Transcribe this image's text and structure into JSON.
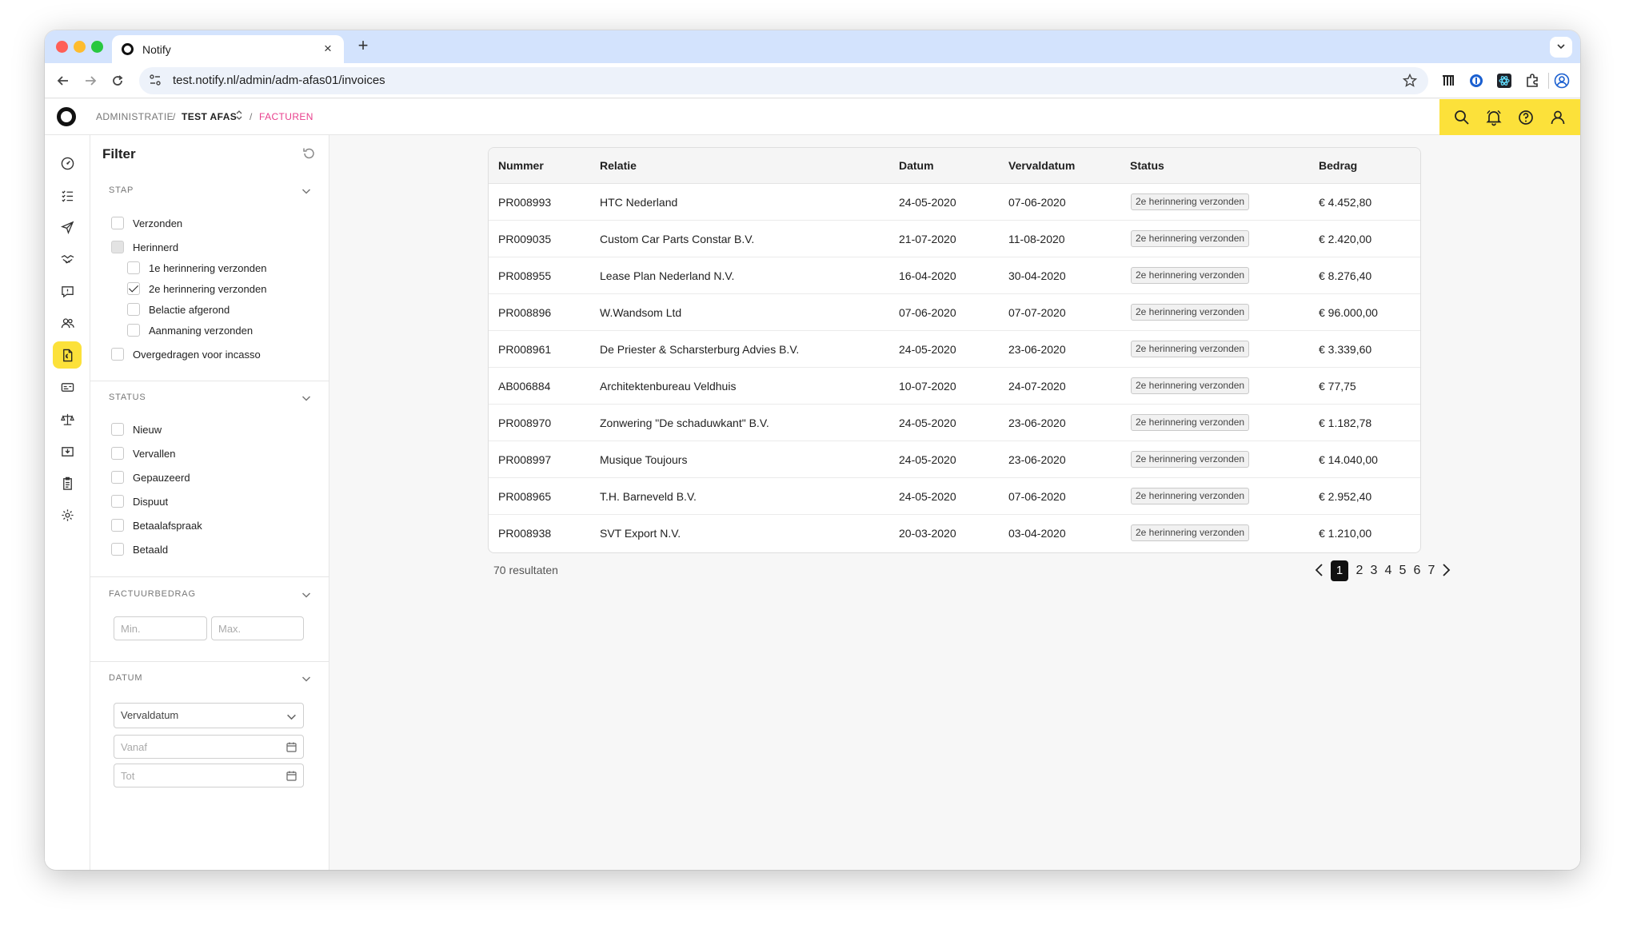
{
  "browser": {
    "tab_title": "Notify",
    "tab_close": "×",
    "new_tab": "+",
    "url": "test.notify.nl/admin/adm-afas01/invoices"
  },
  "header": {
    "breadcrumb": {
      "administratie": "ADMINISTRATIE",
      "sep1": "/",
      "test_afas": "TEST AFAS",
      "sep2": "/",
      "facturen": "FACTUREN"
    }
  },
  "rail": {
    "items": [
      "dashboard-icon",
      "tasks-icon",
      "send-icon",
      "handshake-icon",
      "chat-icon",
      "users-icon",
      "invoice-icon",
      "id-card-icon",
      "scale-icon",
      "inbox-icon",
      "clipboard-icon",
      "settings-icon"
    ],
    "active_index": 6
  },
  "filter": {
    "title": "Filter",
    "sections": {
      "stap": {
        "title": "STAP",
        "options": [
          {
            "label": "Verzonden",
            "state": "unchecked"
          },
          {
            "label": "Herinnerd",
            "state": "indeterminate"
          },
          {
            "label": "1e herinnering verzonden",
            "state": "unchecked",
            "sub": true
          },
          {
            "label": "2e herinnering verzonden",
            "state": "checked",
            "sub": true
          },
          {
            "label": "Belactie afgerond",
            "state": "unchecked",
            "sub": true
          },
          {
            "label": "Aanmaning verzonden",
            "state": "unchecked",
            "sub": true
          },
          {
            "label": "Overgedragen voor incasso",
            "state": "unchecked"
          }
        ]
      },
      "status": {
        "title": "STATUS",
        "options": [
          "Nieuw",
          "Vervallen",
          "Gepauzeerd",
          "Dispuut",
          "Betaalafspraak",
          "Betaald"
        ]
      },
      "factuurbedrag": {
        "title": "FACTUURBEDRAG",
        "min_placeholder": "Min.",
        "max_placeholder": "Max."
      },
      "datum": {
        "title": "DATUM",
        "select_value": "Vervaldatum",
        "from_placeholder": "Vanaf",
        "to_placeholder": "Tot"
      }
    }
  },
  "table": {
    "columns": [
      "Nummer",
      "Relatie",
      "Datum",
      "Vervaldatum",
      "Status",
      "Bedrag"
    ],
    "rows": [
      [
        "PR008993",
        "HTC Nederland",
        "24-05-2020",
        "07-06-2020",
        "2e herinnering verzonden",
        "€ 4.452,80"
      ],
      [
        "PR009035",
        "Custom Car Parts Constar B.V.",
        "21-07-2020",
        "11-08-2020",
        "2e herinnering verzonden",
        "€ 2.420,00"
      ],
      [
        "PR008955",
        "Lease Plan Nederland N.V.",
        "16-04-2020",
        "30-04-2020",
        "2e herinnering verzonden",
        "€ 8.276,40"
      ],
      [
        "PR008896",
        "W.Wandsom Ltd",
        "07-06-2020",
        "07-07-2020",
        "2e herinnering verzonden",
        "€ 96.000,00"
      ],
      [
        "PR008961",
        "De Priester & Scharsterburg Advies B.V.",
        "24-05-2020",
        "23-06-2020",
        "2e herinnering verzonden",
        "€ 3.339,60"
      ],
      [
        "AB006884",
        "Architektenbureau Veldhuis",
        "10-07-2020",
        "24-07-2020",
        "2e herinnering verzonden",
        "€ 77,75"
      ],
      [
        "PR008970",
        "Zonwering \"De schaduwkant\" B.V.",
        "24-05-2020",
        "23-06-2020",
        "2e herinnering verzonden",
        "€ 1.182,78"
      ],
      [
        "PR008997",
        "Musique Toujours",
        "24-05-2020",
        "23-06-2020",
        "2e herinnering verzonden",
        "€ 14.040,00"
      ],
      [
        "PR008965",
        "T.H. Barneveld B.V.",
        "24-05-2020",
        "07-06-2020",
        "2e herinnering verzonden",
        "€ 2.952,40"
      ],
      [
        "PR008938",
        "SVT Export N.V.",
        "20-03-2020",
        "03-04-2020",
        "2e herinnering verzonden",
        "€ 1.210,00"
      ]
    ]
  },
  "results": "70 resultaten",
  "pagination": {
    "pages": [
      "1",
      "2",
      "3",
      "4",
      "5",
      "6",
      "7"
    ],
    "current": "1"
  },
  "colors": {
    "accent_yellow": "#fce13a",
    "breadcrumb_pink": "#e83e8c",
    "tabstrip_blue": "#d3e3fd"
  }
}
